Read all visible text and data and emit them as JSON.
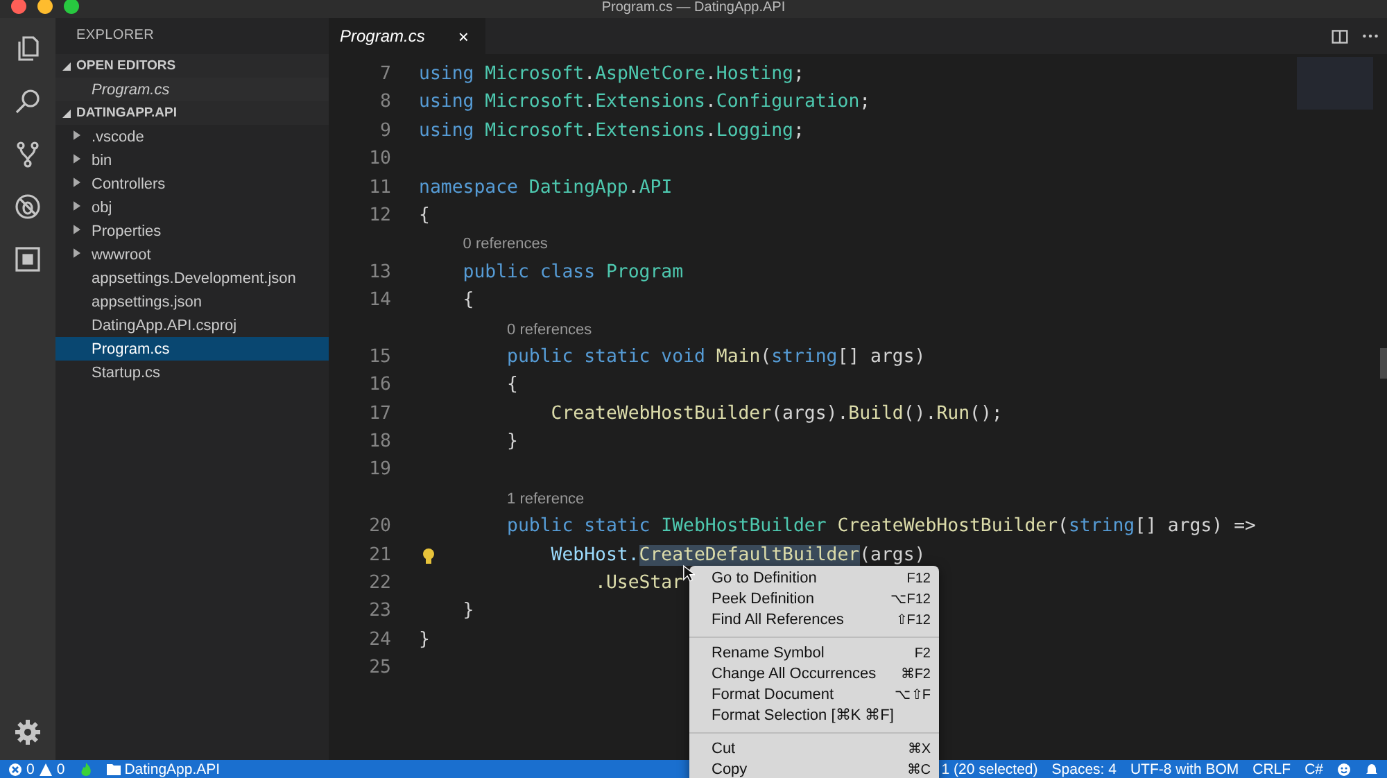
{
  "window": {
    "title": "Program.cs — DatingApp.API"
  },
  "sidebar": {
    "title": "EXPLORER",
    "sections": [
      {
        "title": "OPEN EDITORS",
        "expanded": true,
        "items": [
          {
            "label": "Program.cs",
            "selected": false
          }
        ]
      },
      {
        "title": "DATINGAPP.API",
        "expanded": true,
        "items": [
          {
            "label": ".vscode",
            "folder": true,
            "selected": false
          },
          {
            "label": "bin",
            "folder": true,
            "selected": false
          },
          {
            "label": "Controllers",
            "folder": true,
            "selected": false
          },
          {
            "label": "obj",
            "folder": true,
            "selected": false
          },
          {
            "label": "Properties",
            "folder": true,
            "selected": false
          },
          {
            "label": "wwwroot",
            "folder": true,
            "selected": false
          },
          {
            "label": "appsettings.Development.json",
            "folder": false,
            "selected": false
          },
          {
            "label": "appsettings.json",
            "folder": false,
            "selected": false
          },
          {
            "label": "DatingApp.API.csproj",
            "folder": false,
            "selected": false
          },
          {
            "label": "Program.cs",
            "folder": false,
            "selected": true
          },
          {
            "label": "Startup.cs",
            "folder": false,
            "selected": false
          }
        ]
      }
    ]
  },
  "tabs": [
    {
      "label": "Program.cs",
      "close": "×",
      "selected": true
    }
  ],
  "editor": {
    "lines": [
      {
        "kind": "code",
        "n": "7",
        "tokens": [
          {
            "t": "using ",
            "kind": "kw"
          },
          {
            "t": "Microsoft",
            "kind": "type"
          },
          {
            "t": ".",
            "kind": "plain"
          },
          {
            "t": "AspNetCore",
            "kind": "type"
          },
          {
            "t": ".",
            "kind": "plain"
          },
          {
            "t": "Hosting",
            "kind": "type"
          },
          {
            "t": ";",
            "kind": "plain"
          }
        ]
      },
      {
        "kind": "code",
        "n": "8",
        "tokens": [
          {
            "t": "using ",
            "kind": "kw"
          },
          {
            "t": "Microsoft",
            "kind": "type"
          },
          {
            "t": ".",
            "kind": "plain"
          },
          {
            "t": "Extensions",
            "kind": "type"
          },
          {
            "t": ".",
            "kind": "plain"
          },
          {
            "t": "Configuration",
            "kind": "type"
          },
          {
            "t": ";",
            "kind": "plain"
          }
        ]
      },
      {
        "kind": "code",
        "n": "9",
        "tokens": [
          {
            "t": "using ",
            "kind": "kw"
          },
          {
            "t": "Microsoft",
            "kind": "type"
          },
          {
            "t": ".",
            "kind": "plain"
          },
          {
            "t": "Extensions",
            "kind": "type"
          },
          {
            "t": ".",
            "kind": "plain"
          },
          {
            "t": "Logging",
            "kind": "type"
          },
          {
            "t": ";",
            "kind": "plain"
          }
        ]
      },
      {
        "kind": "code",
        "n": "10"
      },
      {
        "kind": "code",
        "n": "11",
        "tokens": [
          {
            "t": "namespace ",
            "kind": "kw"
          },
          {
            "t": "DatingApp",
            "kind": "type"
          },
          {
            "t": ".",
            "kind": "plain"
          },
          {
            "t": "API",
            "kind": "type"
          }
        ]
      },
      {
        "kind": "code",
        "n": "12",
        "tokens": [
          {
            "t": "{",
            "kind": "plain"
          }
        ]
      },
      {
        "kind": "lens",
        "text": "0 references"
      },
      {
        "kind": "code",
        "n": "13",
        "tokens": [
          {
            "t": "    public class ",
            "kind": "kw"
          },
          {
            "t": "Program",
            "kind": "type"
          }
        ]
      },
      {
        "kind": "code",
        "n": "14",
        "tokens": [
          {
            "t": "    {",
            "kind": "plain"
          }
        ]
      },
      {
        "kind": "lens",
        "text": "0 references"
      },
      {
        "kind": "code",
        "n": "15",
        "tokens": [
          {
            "t": "        public static void ",
            "kind": "kw"
          },
          {
            "t": "Main",
            "kind": "fn"
          },
          {
            "t": "(",
            "kind": "plain"
          },
          {
            "t": "string",
            "kind": "kw"
          },
          {
            "t": "[] args)",
            "kind": "plain"
          }
        ]
      },
      {
        "kind": "code",
        "n": "16",
        "tokens": [
          {
            "t": "        {",
            "kind": "plain"
          }
        ]
      },
      {
        "kind": "code",
        "n": "17",
        "tokens": [
          {
            "t": "            CreateWebHostBuilder",
            "kind": "fn"
          },
          {
            "t": "(args).",
            "kind": "plain"
          },
          {
            "t": "Build",
            "kind": "fn"
          },
          {
            "t": "().",
            "kind": "plain"
          },
          {
            "t": "Run",
            "kind": "fn"
          },
          {
            "t": "();",
            "kind": "plain"
          }
        ]
      },
      {
        "kind": "code",
        "n": "18",
        "tokens": [
          {
            "t": "        }",
            "kind": "plain"
          }
        ]
      },
      {
        "kind": "code",
        "n": "19"
      },
      {
        "kind": "lens",
        "text": "1 reference"
      },
      {
        "kind": "code",
        "n": "20",
        "tokens": [
          {
            "t": "        public static ",
            "kind": "kw"
          },
          {
            "t": "IWebHostBuilder ",
            "kind": "type"
          },
          {
            "t": "CreateWebHostBuilder",
            "kind": "fn"
          },
          {
            "t": "(",
            "kind": "plain"
          },
          {
            "t": "string",
            "kind": "kw"
          },
          {
            "t": "[] args) =>",
            "kind": "plain"
          }
        ]
      },
      {
        "kind": "code",
        "n": "21",
        "lightbulb": true,
        "tokens": [
          {
            "t": "            WebHost.",
            "kind": "var"
          },
          {
            "t": "CreateDefaultBuilder",
            "kind": "match"
          },
          {
            "t": "(args)",
            "kind": "plain"
          }
        ]
      },
      {
        "kind": "code",
        "n": "22",
        "tokens": [
          {
            "t": "                .UseStar",
            "kind": "fn"
          }
        ]
      },
      {
        "kind": "code",
        "n": "23",
        "tokens": [
          {
            "t": "    }",
            "kind": "plain"
          }
        ]
      },
      {
        "kind": "code",
        "n": "24",
        "tokens": [
          {
            "t": "}",
            "kind": "plain"
          }
        ]
      },
      {
        "kind": "code",
        "n": "25"
      }
    ]
  },
  "context_menu": {
    "groups": [
      [
        {
          "label": "Go to Definition",
          "shortcut": "F12"
        },
        {
          "label": "Peek Definition",
          "shortcut": "⌥F12"
        },
        {
          "label": "Find All References",
          "shortcut": "⇧F12"
        }
      ],
      [
        {
          "label": "Rename Symbol",
          "shortcut": "F2"
        },
        {
          "label": "Change All Occurrences",
          "shortcut": "⌘F2"
        },
        {
          "label": "Format Document",
          "shortcut": "⌥⇧F"
        },
        {
          "label": "Format Selection [⌘K ⌘F]"
        }
      ],
      [
        {
          "label": "Cut",
          "shortcut": "⌘X"
        },
        {
          "label": "Copy",
          "shortcut": "⌘C"
        }
      ]
    ]
  },
  "status_bar": {
    "errors": "0",
    "warnings": "0",
    "folder": "DatingApp.API",
    "right": [
      "1 (20 selected)",
      "Spaces: 4",
      "UTF-8 with BOM",
      "CRLF",
      "C#"
    ]
  }
}
